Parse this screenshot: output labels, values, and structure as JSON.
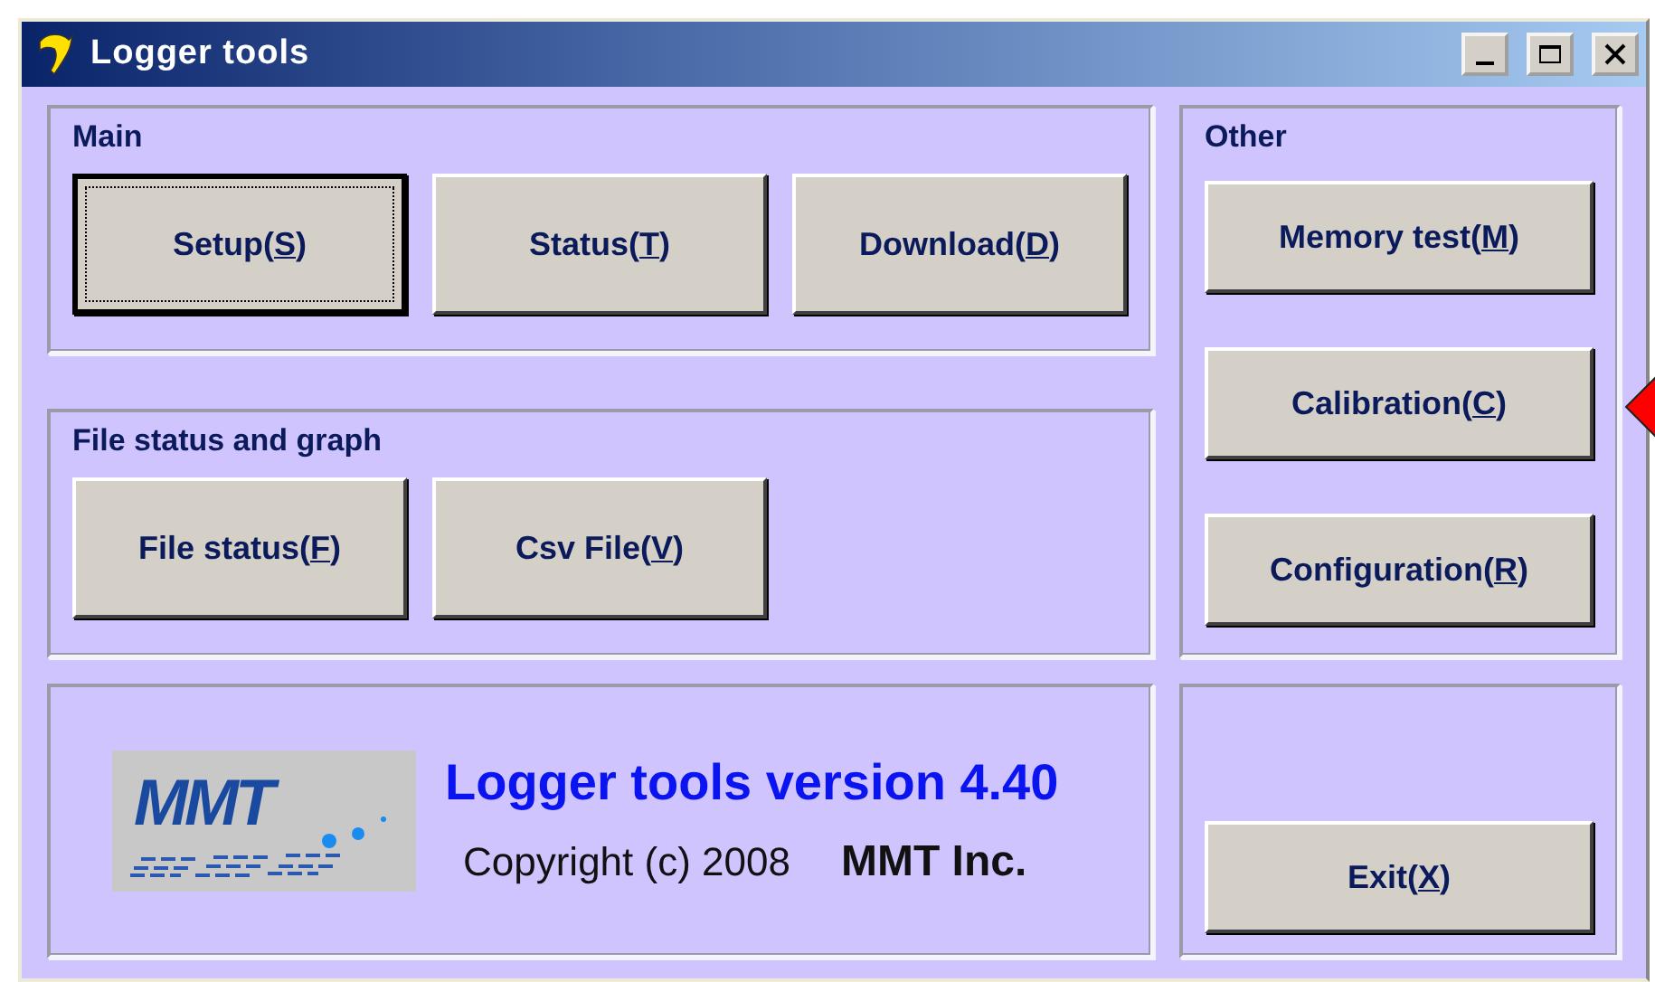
{
  "window": {
    "title": "Logger tools",
    "controls": [
      {
        "kind": "minimize"
      },
      {
        "kind": "maximize"
      },
      {
        "kind": "close"
      }
    ]
  },
  "main_group": {
    "title": "Main",
    "buttons": [
      {
        "label": "Setup(",
        "access_key": "S",
        "label_end": ")",
        "focused": true
      },
      {
        "label": "Status(",
        "access_key": "T",
        "label_end": ")",
        "focused": false
      },
      {
        "label": "Download(",
        "access_key": "D",
        "label_end": ")",
        "focused": false
      }
    ]
  },
  "file_group": {
    "title": "File status and graph",
    "buttons": [
      {
        "label": "File status(",
        "access_key": "F",
        "label_end": ")",
        "focused": false
      },
      {
        "label": "Csv File(",
        "access_key": "V",
        "label_end": ")",
        "focused": false
      }
    ]
  },
  "about": {
    "logo_text": "MMT",
    "version": "Logger tools version 4.40",
    "copyright": "Copyright (c) 2008",
    "company": "MMT Inc."
  },
  "other_group": {
    "title": "Other",
    "buttons": [
      {
        "label": "Memory test(",
        "access_key": "M",
        "label_end": ")",
        "focused": false
      },
      {
        "label": "Calibration(",
        "access_key": "C",
        "label_end": ")",
        "focused": false
      },
      {
        "label": "Configuration(",
        "access_key": "R",
        "label_end": ")",
        "focused": false
      }
    ]
  },
  "exit_button": {
    "label": "Exit(",
    "access_key": "X",
    "label_end": ")",
    "focused": false
  }
}
